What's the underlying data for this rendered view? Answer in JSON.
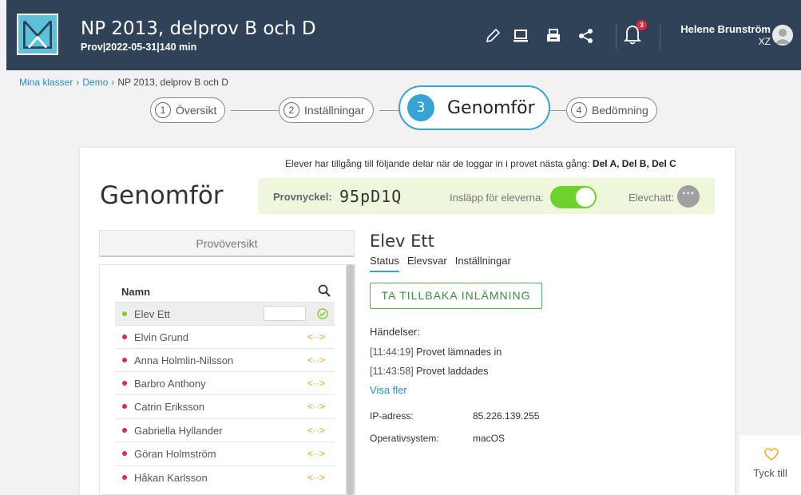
{
  "header": {
    "title": "NP 2013, delprov B och D",
    "subtitle": "Prov|2022-05-31|140 min",
    "icons": [
      "pencil-icon",
      "laptop-icon",
      "printer-icon",
      "share-icon",
      "bell-icon"
    ],
    "notification_count": "3",
    "user_name": "Helene Brunström",
    "user_code": "XZ"
  },
  "breadcrumb": {
    "items": [
      "Mina klasser",
      "Demo",
      "NP 2013, delprov B och D"
    ]
  },
  "stepper": {
    "steps": [
      {
        "num": "1",
        "label": "Översikt"
      },
      {
        "num": "2",
        "label": "Inställningar"
      },
      {
        "num": "3",
        "label": "Genomför"
      },
      {
        "num": "4",
        "label": "Bedömning"
      }
    ],
    "active_index": 2
  },
  "access": {
    "text": "Elever har tillgång till följande delar när de loggar in i provet nästa gång: ",
    "parts": "Del A, Del B, Del C"
  },
  "main": {
    "heading": "Genomför",
    "key_label": "Provnyckel:",
    "key_value": "95pD1Q",
    "entry_label": "Insläpp för eleverna:",
    "entry_enabled": true,
    "chat_label": "Elevchatt:"
  },
  "overview_button": "Provöversikt",
  "student_list": {
    "header": "Namn",
    "students": [
      {
        "name": "Elev Ett",
        "status": "done",
        "selected": true,
        "dot_color": "#7fca3a"
      },
      {
        "name": "Elvin Grund",
        "status": "<··>",
        "selected": false,
        "dot_color": "#e6284f"
      },
      {
        "name": "Anna Holmlin-Nilsson",
        "status": "<··>",
        "selected": false,
        "dot_color": "#e6284f"
      },
      {
        "name": "Barbro Anthony",
        "status": "<··>",
        "selected": false,
        "dot_color": "#e6284f"
      },
      {
        "name": "Catrin Eriksson",
        "status": "<··>",
        "selected": false,
        "dot_color": "#e6284f"
      },
      {
        "name": "Gabriella Hyllander",
        "status": "<··>",
        "selected": false,
        "dot_color": "#e6284f"
      },
      {
        "name": "Göran Holmström",
        "status": "<··>",
        "selected": false,
        "dot_color": "#e6284f"
      },
      {
        "name": "Håkan Karlsson",
        "status": "<··>",
        "selected": false,
        "dot_color": "#e6284f"
      }
    ]
  },
  "student_detail": {
    "name": "Elev Ett",
    "tabs": [
      "Status",
      "Elevsvar",
      "Inställningar"
    ],
    "active_tab": 0,
    "withdraw_button": "TA TILLBAKA INLÄMNING",
    "events_label": "Händelser:",
    "events": [
      {
        "time": "[11:44:19]",
        "text": "Provet lämnades in"
      },
      {
        "time": "[11:43:58]",
        "text": "Provet laddades"
      }
    ],
    "show_more": "Visa fler",
    "ip_label": "IP-adress:",
    "ip_value": "85.226.139.255",
    "os_label": "Operativsystem:",
    "os_value": "macOS"
  },
  "feedback": {
    "label": "Tyck till"
  },
  "colors": {
    "header_bg": "#2f4257",
    "accent_blue": "#36a3d2",
    "toggle_green": "#6ed12c",
    "key_bar_bg": "#eef6dc",
    "status_orange": "#f0a01e",
    "dot_red": "#e6284f",
    "dot_green": "#7fca3a"
  }
}
